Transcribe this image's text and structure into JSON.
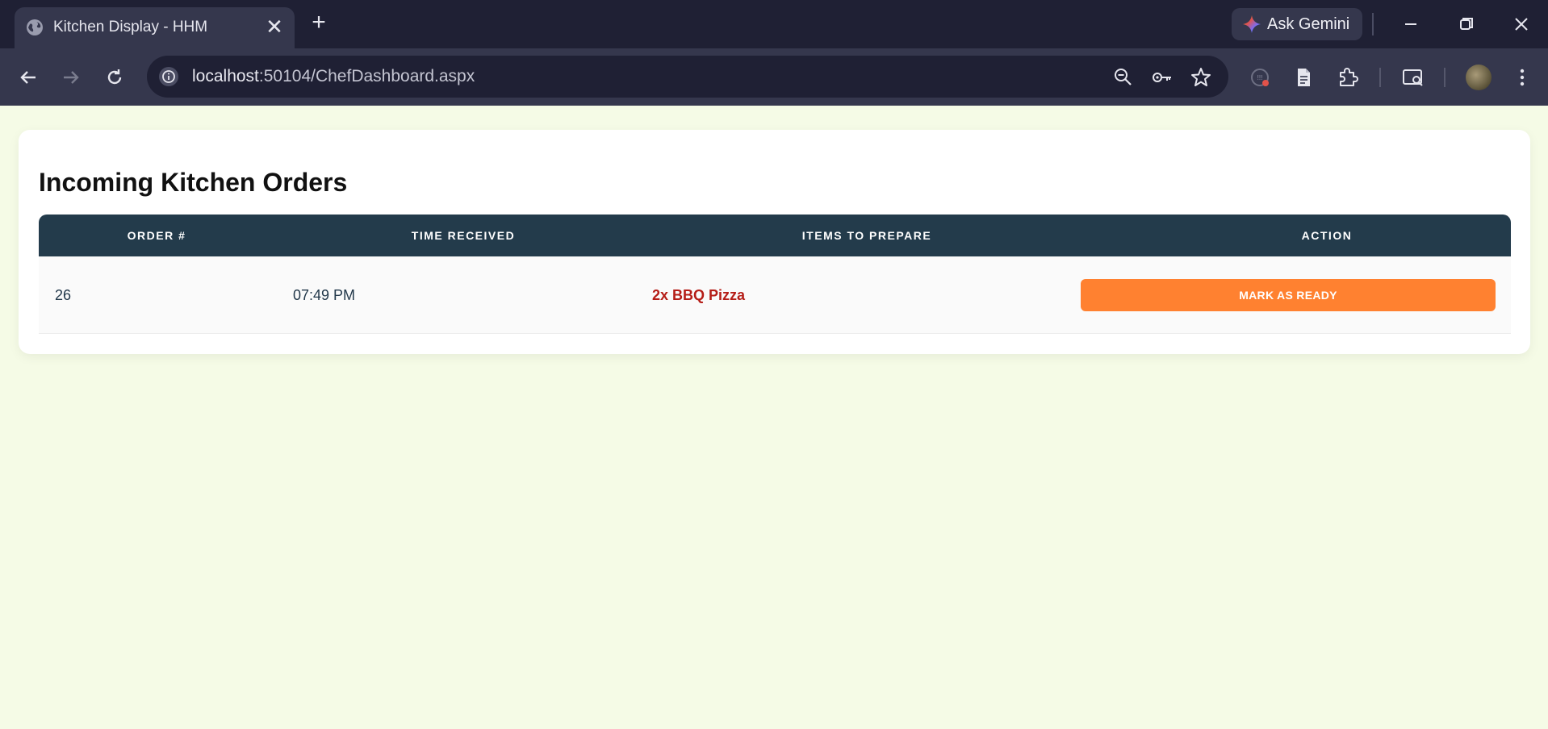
{
  "browser": {
    "tab_title": "Kitchen Display - HHM",
    "close_tab_glyph": "✕",
    "new_tab_glyph": "+",
    "gemini_label": "Ask Gemini",
    "url_host": "localhost",
    "url_path": ":50104/ChefDashboard.aspx",
    "icons": [
      "globe-icon",
      "sparkle-icon",
      "minimize-icon",
      "restore-icon",
      "close-icon",
      "back-icon",
      "forward-icon",
      "reload-icon",
      "site-info-icon",
      "zoom-icon",
      "password-key-icon",
      "bookmark-star-icon",
      "extension-icon",
      "reading-mode-icon",
      "puzzle-icon",
      "tab-search-icon",
      "avatar",
      "more-icon"
    ]
  },
  "page": {
    "heading": "Incoming Kitchen Orders",
    "columns": [
      "ORDER #",
      "TIME RECEIVED",
      "ITEMS TO PREPARE",
      "ACTION"
    ],
    "orders": [
      {
        "order_no": "26",
        "time": "07:49 PM",
        "items": "2x BBQ Pizza",
        "action_label": "MARK AS READY"
      }
    ]
  },
  "colors": {
    "page_background": "#f5fbe6",
    "header_background": "#233b4b",
    "items_text": "#b51d17",
    "action_button": "#ff8130",
    "chrome_dark": "#1f2034",
    "chrome_mid": "#35374d"
  }
}
